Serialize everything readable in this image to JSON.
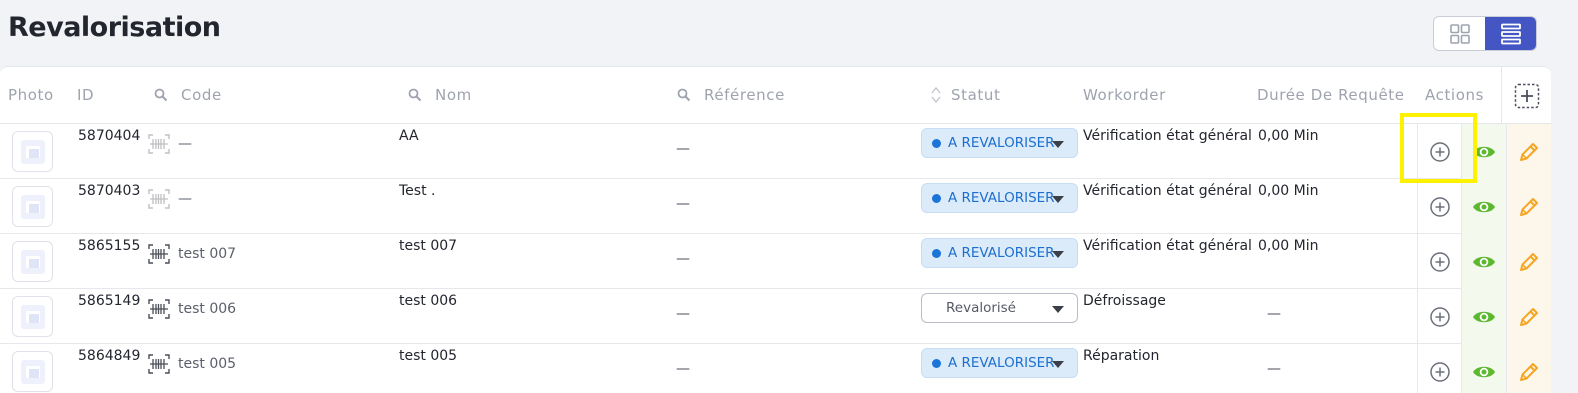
{
  "page": {
    "title": "Revalorisation"
  },
  "view_toggle": {
    "grid_icon": "grid-icon",
    "list_icon": "list-icon",
    "active": "list"
  },
  "table": {
    "columns": {
      "photo": "Photo",
      "id": "ID",
      "code": "Code",
      "nom": "Nom",
      "reference": "Référence",
      "statut": "Statut",
      "workorder": "Workorder",
      "duree": "Durée De Requête",
      "actions": "Actions"
    },
    "rows": [
      {
        "id": "5870404",
        "code": "—",
        "nom": "AA",
        "reference": "—",
        "statut": "A REVALORISER",
        "workorder": "Vérification état général",
        "duree": "0,00 Min"
      },
      {
        "id": "5870403",
        "code": "—",
        "nom": "Test .",
        "reference": "—",
        "statut": "A REVALORISER",
        "workorder": "Vérification état général",
        "duree": "0,00 Min"
      },
      {
        "id": "5865155",
        "code": "test 007",
        "nom": "test 007",
        "reference": "—",
        "statut": "A REVALORISER",
        "workorder": "Vérification état général",
        "duree": "0,00 Min"
      },
      {
        "id": "5865149",
        "code": "test 006",
        "nom": "test 006",
        "reference": "—",
        "statut": "Revalorisé",
        "workorder": "Défroissage",
        "duree": "—"
      },
      {
        "id": "5864849",
        "code": "test 005",
        "nom": "test 005",
        "reference": "—",
        "statut": "A REVALORISER",
        "workorder": "Réparation",
        "duree": "—"
      }
    ]
  },
  "colors": {
    "accent": "#4356c4",
    "status_blue": "#1b74d8",
    "view_green": "#5cb82e",
    "edit_orange": "#f5a623",
    "highlight": "#fff200"
  }
}
